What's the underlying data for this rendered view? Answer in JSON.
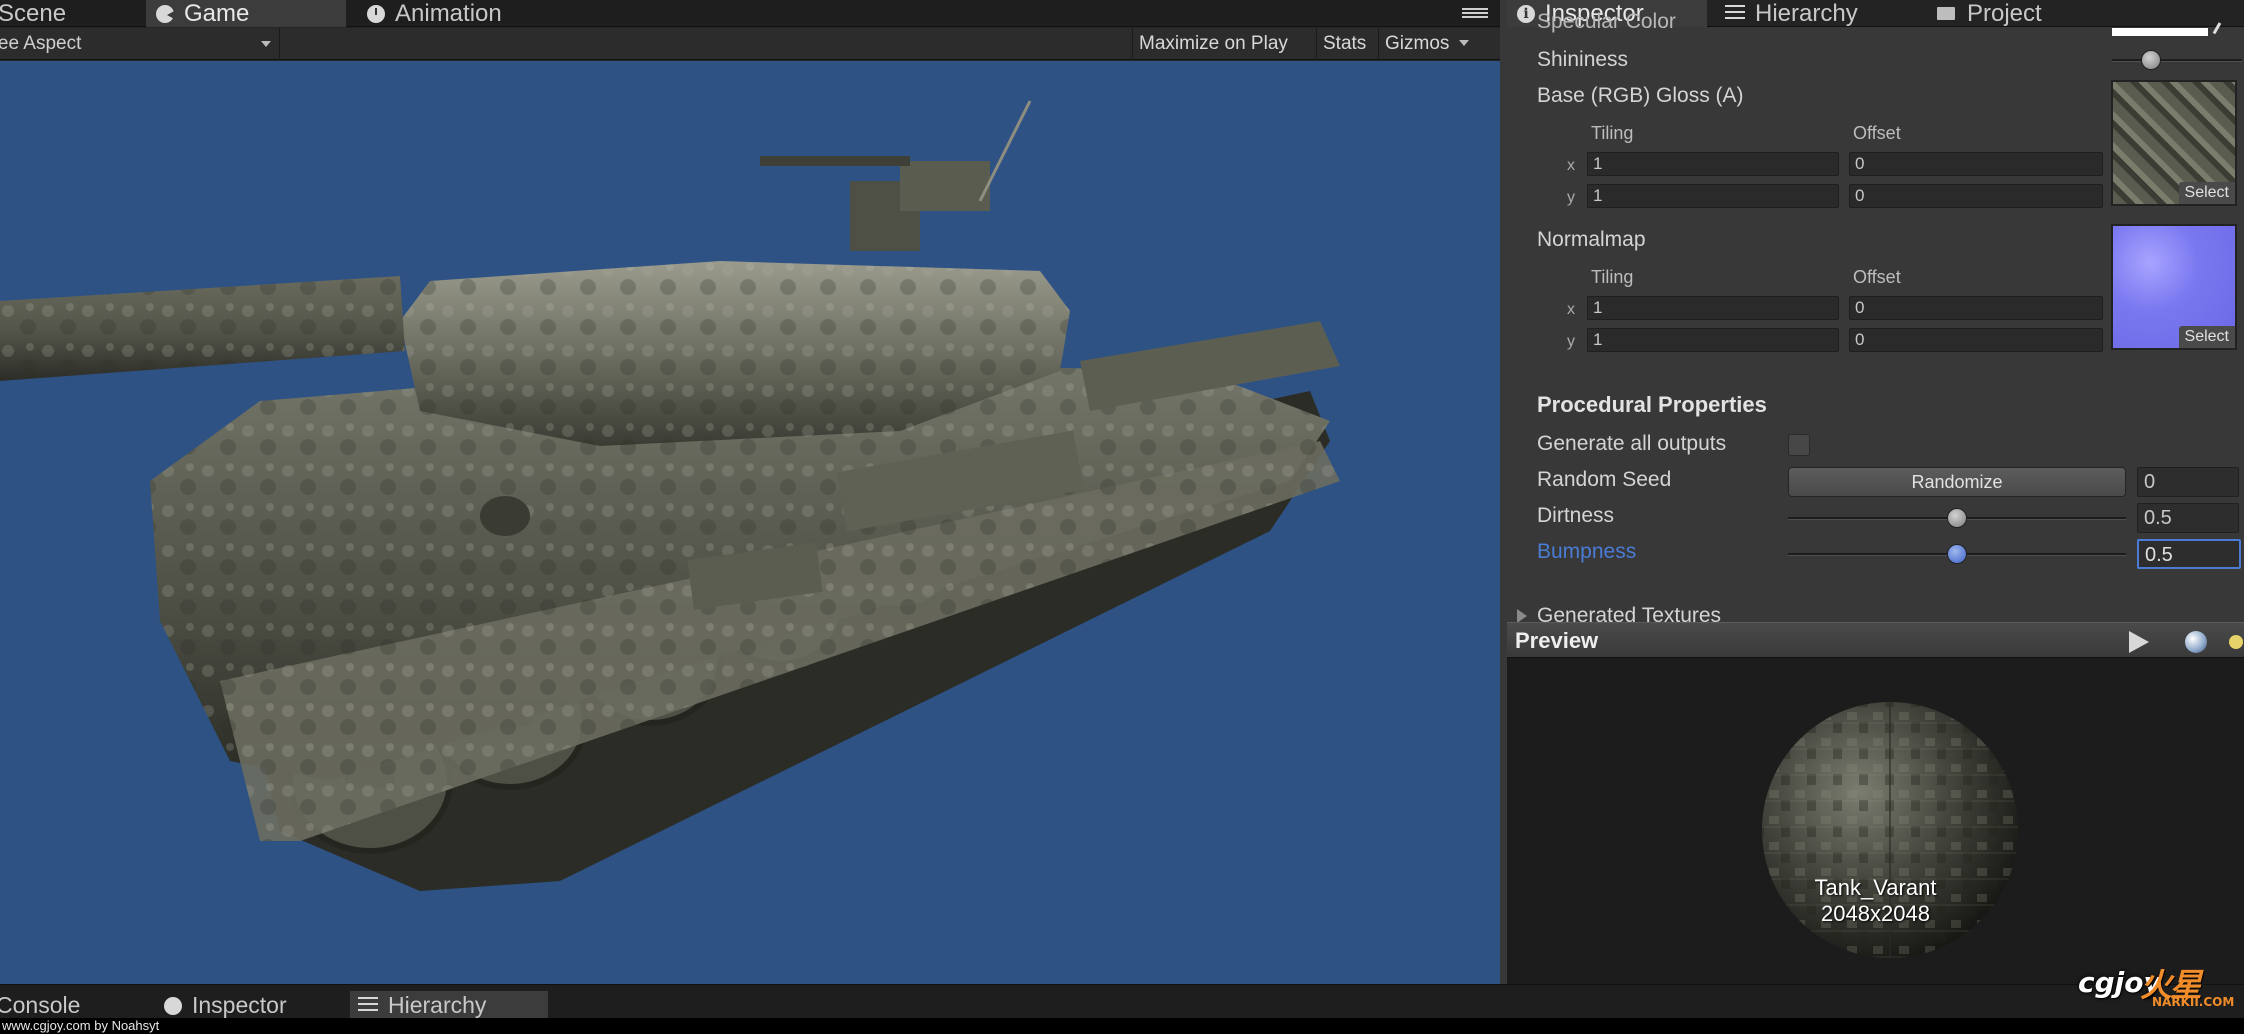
{
  "game": {
    "tabs": [
      {
        "label": "Scene",
        "active": false,
        "icon": "scene-icon"
      },
      {
        "label": "Game",
        "active": true,
        "icon": "pacman-icon"
      },
      {
        "label": "Animation",
        "active": false,
        "icon": "clock-icon"
      }
    ],
    "aspect_label": "Free Aspect",
    "toolbar": {
      "maximize_label": "Maximize on Play",
      "stats_label": "Stats",
      "gizmos_label": "Gizmos"
    },
    "viewport_bg": "#2e5284"
  },
  "inspector": {
    "tabs": [
      {
        "label": "Inspector",
        "active": true,
        "icon": "info-icon"
      },
      {
        "label": "Hierarchy",
        "active": false,
        "icon": "list-icon"
      },
      {
        "label": "Project",
        "active": false,
        "icon": "folder-icon"
      }
    ],
    "cut_label": "Specular Color",
    "shininess_label": "Shininess",
    "shininess_value": 0.3,
    "base": {
      "label": "Base (RGB) Gloss (A)",
      "tiling_label": "Tiling",
      "offset_label": "Offset",
      "x_label": "x",
      "y_label": "y",
      "tiling_x": "1",
      "tiling_y": "1",
      "offset_x": "0",
      "offset_y": "0",
      "select_label": "Select"
    },
    "normal": {
      "label": "Normalmap",
      "tiling_label": "Tiling",
      "offset_label": "Offset",
      "x_label": "x",
      "y_label": "y",
      "tiling_x": "1",
      "tiling_y": "1",
      "offset_x": "0",
      "offset_y": "0",
      "select_label": "Select"
    },
    "procedural": {
      "title": "Procedural Properties",
      "generate_label": "Generate all outputs",
      "generate_checked": false,
      "seed_label": "Random Seed",
      "randomize_label": "Randomize",
      "seed_value": "0",
      "dirtness_label": "Dirtness",
      "dirtness_value": "0.5",
      "dirtness_fraction": 0.5,
      "bumpness_label": "Bumpness",
      "bumpness_value": "0.5",
      "bumpness_fraction": 0.5,
      "accent": "#4a7cd6"
    },
    "generated_label": "Generated Textures"
  },
  "preview": {
    "title": "Preview",
    "name": "Tank_Varant",
    "size": "2048x2048"
  },
  "bottom": {
    "tabs": [
      {
        "label": "Console",
        "active": false
      },
      {
        "label": "Inspector",
        "active": false
      },
      {
        "label": "Hierarchy",
        "active": true
      }
    ]
  },
  "watermark": {
    "credit": "www.cgjoy.com by Noahsyt",
    "logo_text": "cgjoy",
    "logo_cn": "火星",
    "logo_sub": "NARKII.COM"
  }
}
